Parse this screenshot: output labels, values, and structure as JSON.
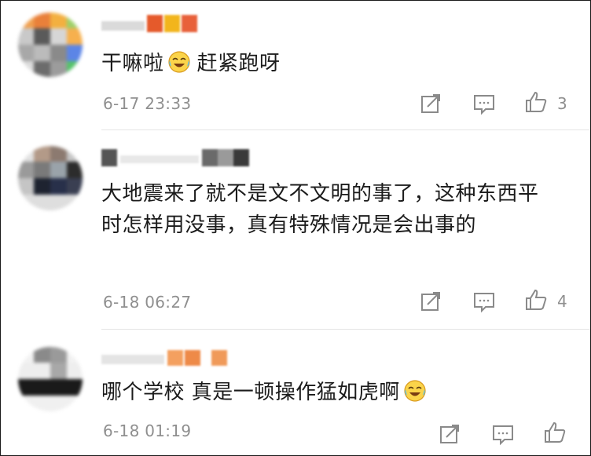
{
  "comments": [
    {
      "text": "干嘛啦",
      "text_after_emoji": "赶紧跑呀",
      "emoji": "laugh-cry-emoji",
      "time": "6-17 23:33",
      "likes": "3"
    },
    {
      "text": "大地震来了就不是文不文明的事了，这种东西平时怎样用没事，真有特殊情况是会出事的",
      "time": "6-18 06:27",
      "likes": "4"
    },
    {
      "text": "哪个学校 真是一顿操作猛如虎啊",
      "emoji": "laugh-cry-emoji",
      "time": "6-18 01:19",
      "likes": ""
    }
  ],
  "colors": {
    "text": "#1b1b1b",
    "meta": "#8f8f8f",
    "icon": "#8a8a8a",
    "divider": "#e4e4e4",
    "border": "#1a1a1a"
  },
  "icons": [
    "repost-icon",
    "comment-icon",
    "thumbs-up-icon",
    "laugh-cry-emoji"
  ]
}
